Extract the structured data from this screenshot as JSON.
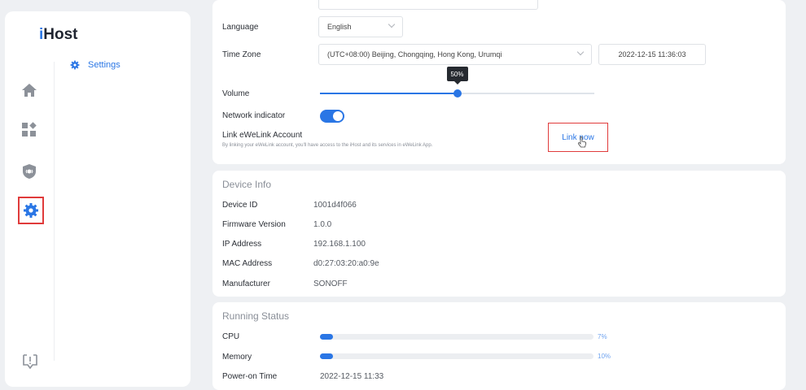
{
  "app": {
    "logo_prefix": "i",
    "logo_rest": "Host"
  },
  "nav": {
    "icons": [
      "home-icon",
      "devices-icon",
      "security-icon",
      "settings-icon"
    ],
    "active": "settings-icon",
    "bottom_icon": "feedback-icon",
    "submenu_label": "Settings"
  },
  "settings": {
    "language_label": "Language",
    "language_value": "English",
    "timezone_label": "Time Zone",
    "timezone_value": "(UTC+08:00) Beijing, Chongqing, Hong Kong, Urumqi",
    "datetime_value": "2022-12-15 11:36:03",
    "volume_label": "Volume",
    "volume_percent": 50,
    "volume_tooltip": "50%",
    "network_indicator_label": "Network indicator",
    "network_indicator_on": true,
    "link_title": "Link eWeLink Account",
    "link_desc": "By linking your eWeLink account, you'll have access to the iHost and its services in eWeLink App.",
    "link_button": "Link now"
  },
  "device_info": {
    "title": "Device Info",
    "rows": [
      {
        "label": "Device ID",
        "value": "1001d4f066"
      },
      {
        "label": "Firmware Version",
        "value": "1.0.0"
      },
      {
        "label": "IP Address",
        "value": "192.168.1.100"
      },
      {
        "label": "MAC Address",
        "value": "d0:27:03:20:a0:9e"
      },
      {
        "label": "Manufacturer",
        "value": "SONOFF"
      }
    ]
  },
  "running_status": {
    "title": "Running Status",
    "cpu_label": "CPU",
    "cpu_percent": 7,
    "cpu_text": "7%",
    "memory_label": "Memory",
    "memory_percent": 10,
    "memory_text": "10%",
    "power_on_label": "Power-on Time",
    "power_on_value": "2022-12-15 11:33"
  },
  "colors": {
    "accent": "#2a76e5",
    "highlight": "#e03b3b",
    "background": "#eef0f3"
  }
}
